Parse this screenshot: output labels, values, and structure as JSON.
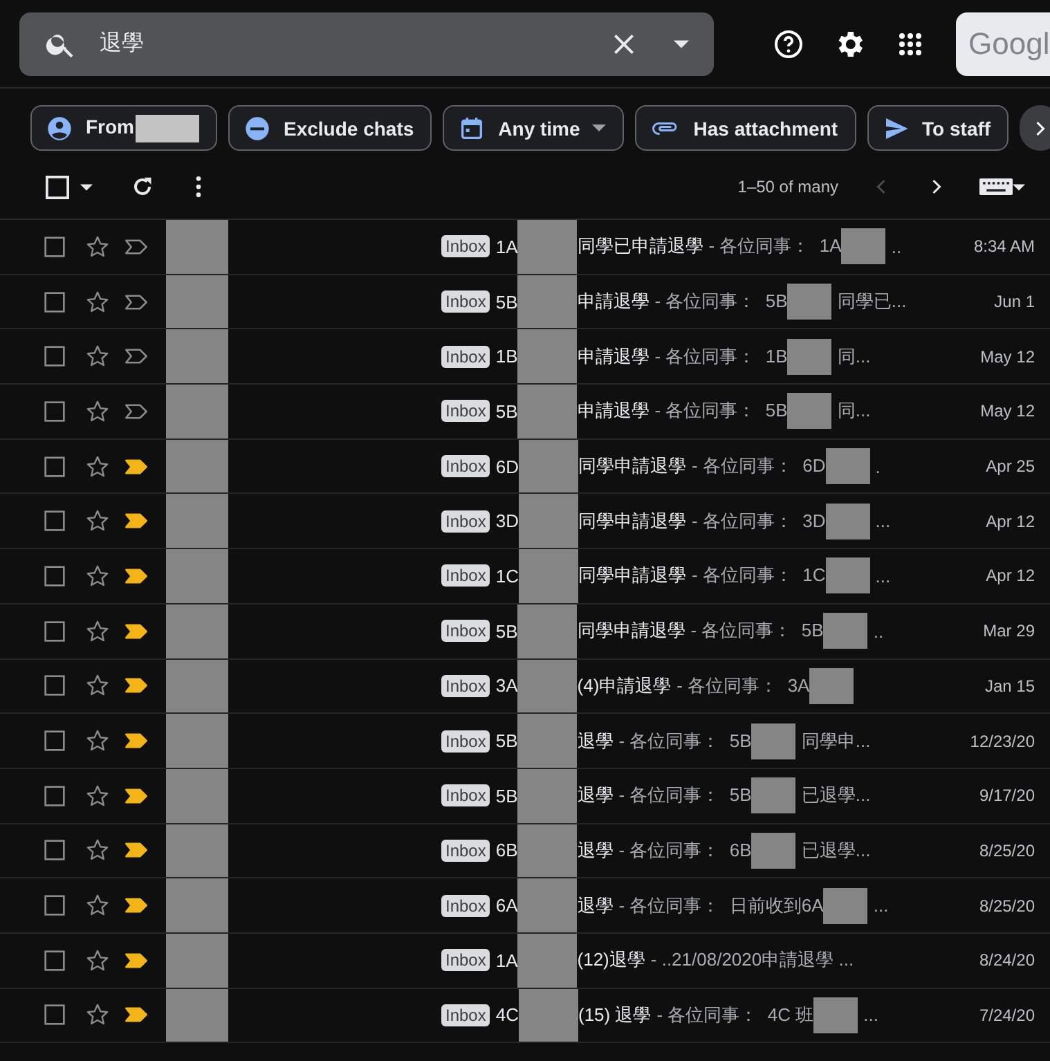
{
  "search": {
    "value": "退學"
  },
  "logo": {
    "text": "Googl"
  },
  "chips": [
    {
      "kind": "person",
      "label": "From",
      "redacted": true,
      "caret": false
    },
    {
      "kind": "minus",
      "label": "Exclude chats",
      "redacted": false,
      "caret": false
    },
    {
      "kind": "calendar",
      "label": "Any time",
      "redacted": false,
      "caret": true
    },
    {
      "kind": "clip",
      "label": "Has attachment",
      "redacted": false,
      "caret": false
    },
    {
      "kind": "send",
      "label": "To staff",
      "redacted": false,
      "caret": false
    }
  ],
  "pager": {
    "range": "1–50 of many",
    "prev_disabled": true
  },
  "select_all": {
    "checked": false
  },
  "rows": [
    {
      "checked": false,
      "label": "Inbox",
      "prefix": "1A",
      "subject": "同學已申請退學",
      "snippet": "- 各位同事：  1A",
      "snippet_redacted": true,
      "snippet_end": "..",
      "date": "8:34 AM",
      "important": false
    },
    {
      "checked": false,
      "label": "Inbox",
      "prefix": "5B",
      "subject": "申請退學",
      "snippet": "- 各位同事：  5B",
      "snippet_redacted": true,
      "snippet_end": "同學已...",
      "date": "Jun 1",
      "important": false
    },
    {
      "checked": false,
      "label": "Inbox",
      "prefix": "1B",
      "subject": "申請退學",
      "snippet": "- 各位同事：  1B",
      "snippet_redacted": true,
      "snippet_end": "同...",
      "date": "May 12",
      "important": false
    },
    {
      "checked": false,
      "label": "Inbox",
      "prefix": "5B",
      "subject": "申請退學",
      "snippet": "- 各位同事：  5B",
      "snippet_redacted": true,
      "snippet_end": "同...",
      "date": "May 12",
      "important": false
    },
    {
      "checked": false,
      "label": "Inbox",
      "prefix": "6D",
      "subject": "同學申請退學",
      "snippet": "- 各位同事：  6D",
      "snippet_redacted": true,
      "snippet_end": ".",
      "date": "Apr 25",
      "important": true
    },
    {
      "checked": false,
      "label": "Inbox",
      "prefix": "3D",
      "subject": "同學申請退學",
      "snippet": "- 各位同事：  3D",
      "snippet_redacted": true,
      "snippet_end": "...",
      "date": "Apr 12",
      "important": true
    },
    {
      "checked": false,
      "label": "Inbox",
      "prefix": "1C",
      "subject": "同學申請退學",
      "snippet": "- 各位同事：  1C",
      "snippet_redacted": true,
      "snippet_end": "...",
      "date": "Apr 12",
      "important": true
    },
    {
      "checked": false,
      "label": "Inbox",
      "prefix": "5B",
      "subject": "同學申請退學",
      "snippet": "- 各位同事：  5B",
      "snippet_redacted": true,
      "snippet_end": "..",
      "date": "Mar 29",
      "important": true
    },
    {
      "checked": false,
      "label": "Inbox",
      "prefix": "3A",
      "subject": "(4)申請退學",
      "snippet": "- 各位同事：  3A",
      "snippet_redacted": true,
      "date": "Jan 15",
      "important": true
    },
    {
      "checked": false,
      "label": "Inbox",
      "prefix": "5B",
      "subject": "退學",
      "snippet": "- 各位同事：  5B",
      "snippet_redacted": true,
      "snippet_end": "同學申...",
      "date": "12/23/20",
      "important": true
    },
    {
      "checked": false,
      "label": "Inbox",
      "prefix": "5B",
      "subject": "退學",
      "snippet": "- 各位同事：  5B",
      "snippet_redacted": true,
      "snippet_end": "已退學...",
      "date": "9/17/20",
      "important": true
    },
    {
      "checked": false,
      "label": "Inbox",
      "prefix": "6B",
      "subject": "退學",
      "snippet": "- 各位同事：  6B",
      "snippet_redacted": true,
      "snippet_end": "已退學...",
      "date": "8/25/20",
      "important": true
    },
    {
      "checked": false,
      "label": "Inbox",
      "prefix": "6A",
      "subject": "退學",
      "snippet": "- 各位同事：  日前收到6A",
      "snippet_redacted": true,
      "snippet_end": "...",
      "date": "8/25/20",
      "important": true
    },
    {
      "checked": false,
      "label": "Inbox",
      "prefix": "1A",
      "subject": "(12)退學",
      "snippet": "- ..21/08/2020申請退學 ...",
      "snippet_redacted": false,
      "date": "8/24/20",
      "important": true
    },
    {
      "checked": false,
      "label": "Inbox",
      "prefix": "4C",
      "subject": "(15) 退學",
      "snippet": "- 各位同事：  4C 班",
      "snippet_redacted": true,
      "snippet_end": "...",
      "date": "7/24/20",
      "important": true
    }
  ]
}
